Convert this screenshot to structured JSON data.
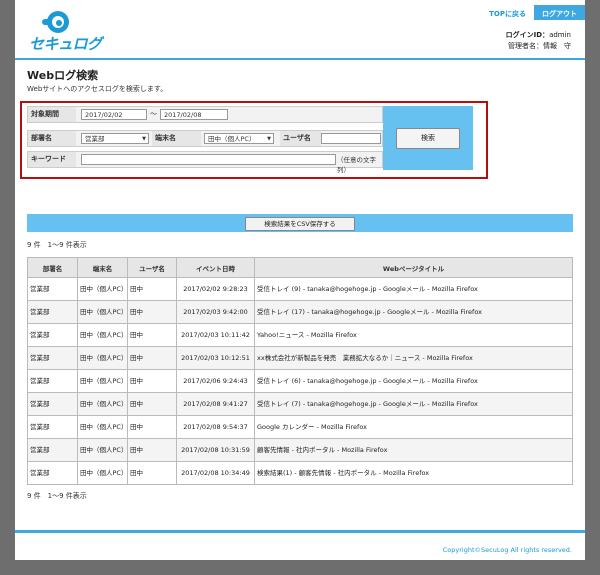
{
  "header": {
    "logo_text": "セキュログ",
    "top_link": "TOPに戻る",
    "logout": "ログアウト",
    "login_id_label": "ログインID：",
    "login_id": "admin",
    "admin_label": "管理者名：",
    "admin_name": "情報　守"
  },
  "page": {
    "title": "Webログ検索",
    "subtitle": "Webサイトへのアクセスログを検索します。"
  },
  "search": {
    "period_label": "対象期間",
    "date_from": "2017/02/02",
    "tilde": "～",
    "date_to": "2017/02/08",
    "dept_label": "部署名",
    "dept_value": "営業部",
    "terminal_label": "端末名",
    "terminal_value": "田中（個人PC）",
    "user_label": "ユーザ名",
    "user_value": "",
    "keyword_label": "キーワード",
    "keyword_value": "",
    "keyword_hint": "（任意の文字列）",
    "search_button": "検索"
  },
  "csv_button": "検索結果をCSV保存する",
  "result_count": "9 件　1～9 件表示",
  "table": {
    "headers": [
      "部署名",
      "端末名",
      "ユーザ名",
      "イベント日時",
      "Webページタイトル"
    ],
    "rows": [
      [
        "営業部",
        "田中（個人PC）",
        "田中",
        "2017/02/02 9:28:23",
        "受信トレイ (9) - tanaka@hogehoge.jp - Googleメール - Mozilla Firefox"
      ],
      [
        "営業部",
        "田中（個人PC）",
        "田中",
        "2017/02/03 9:42:00",
        "受信トレイ (17) - tanaka@hogehoge.jp - Googleメール - Mozilla Firefox"
      ],
      [
        "営業部",
        "田中（個人PC）",
        "田中",
        "2017/02/03 10:11:42",
        "Yahoo!ニュース - Mozilla Firefox"
      ],
      [
        "営業部",
        "田中（個人PC）",
        "田中",
        "2017/02/03 10:12:51",
        "xx株式会社が新製品を発売　業務拡大なるか｜ニュース - Mozilla Firefox"
      ],
      [
        "営業部",
        "田中（個人PC）",
        "田中",
        "2017/02/06 9:24:43",
        "受信トレイ (6) - tanaka@hogehoge.jp - Googleメール - Mozilla Firefox"
      ],
      [
        "営業部",
        "田中（個人PC）",
        "田中",
        "2017/02/08 9:41:27",
        "受信トレイ (7) - tanaka@hogehoge.jp - Googleメール - Mozilla Firefox"
      ],
      [
        "営業部",
        "田中（個人PC）",
        "田中",
        "2017/02/08 9:54:37",
        "Google カレンダー - Mozilla Firefox"
      ],
      [
        "営業部",
        "田中（個人PC）",
        "田中",
        "2017/02/08 10:31:59",
        "顧客先情報 - 社内ポータル - Mozilla Firefox"
      ],
      [
        "営業部",
        "田中（個人PC）",
        "田中",
        "2017/02/08 10:34:49",
        "検索結果(1) - 顧客先情報 - 社内ポータル - Mozilla Firefox"
      ]
    ]
  },
  "bottom_count": "9 件　1～9 件表示",
  "footer": {
    "copyright": "Copyright©SecuLog All rights reserved."
  },
  "colors": {
    "accent": "#3fa8e0",
    "button_panel": "#66c0f0",
    "highlight_border": "#b40e0e",
    "background": "#6e6e6e"
  },
  "icons": {
    "logo": "secure-log-logo-icon",
    "dropdown": "chevron-down-icon"
  }
}
